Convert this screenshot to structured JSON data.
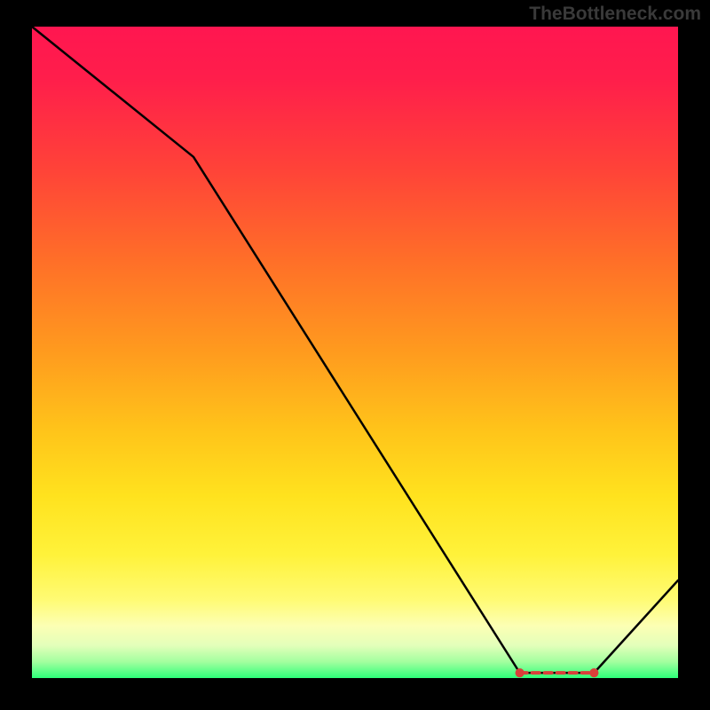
{
  "attribution": "TheBottleneck.com",
  "chart_data": {
    "type": "line",
    "title": "",
    "xlabel": "",
    "ylabel": "",
    "xlim": [
      0,
      100
    ],
    "ylim": [
      0,
      100
    ],
    "x": [
      0,
      25,
      75.5,
      87,
      100
    ],
    "values": [
      100,
      80,
      0.8,
      0.8,
      15
    ],
    "optimal_band": {
      "x_start": 75.5,
      "x_end": 87,
      "y": 0.8
    },
    "note": "Values are read off the plot relative to its own 0–100 axes (no tick labels are shown)."
  }
}
